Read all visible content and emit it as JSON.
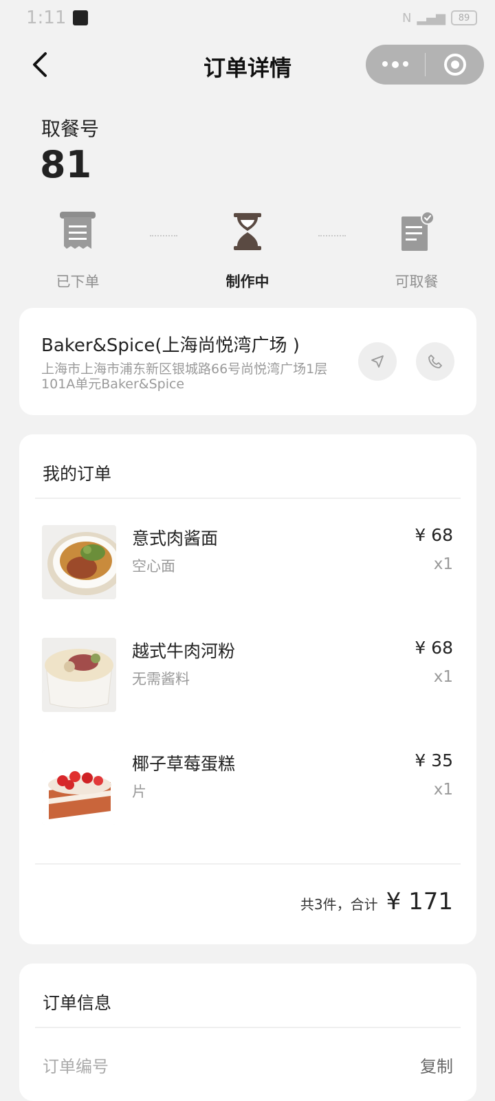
{
  "statusbar": {
    "time": "1:11",
    "battery": "89"
  },
  "navbar": {
    "title": "订单详情"
  },
  "pickup": {
    "label": "取餐号",
    "number": "81"
  },
  "progress": {
    "steps": [
      {
        "label": "已下单",
        "icon": "receipt-icon"
      },
      {
        "label": "制作中",
        "icon": "hourglass-icon"
      },
      {
        "label": "可取餐",
        "icon": "ready-document-icon"
      }
    ],
    "current_step": 2
  },
  "store": {
    "name": "Baker&Spice(上海尚悦湾广场 )",
    "address": "上海市上海市浦东新区银城路66号尚悦湾广场1层101A单元Baker&Spice"
  },
  "order": {
    "title": "我的订单",
    "items": [
      {
        "name": "意式肉酱面",
        "spec": "空心面",
        "price": "¥ 68",
        "qty": "x1"
      },
      {
        "name": "越式牛肉河粉",
        "spec": "无需酱料",
        "price": "¥ 68",
        "qty": "x1"
      },
      {
        "name": "椰子草莓蛋糕",
        "spec": "片",
        "price": "¥ 35",
        "qty": "x1"
      }
    ],
    "summary": "共3件，合计",
    "total": "¥ 171"
  },
  "info": {
    "title": "订单信息",
    "order_no_label": "订单编号",
    "copy_label": "复制"
  },
  "colors": {
    "background": "#f2f2f2",
    "card": "#ffffff",
    "accent_brown": "#5a4a42",
    "muted": "#999999"
  }
}
